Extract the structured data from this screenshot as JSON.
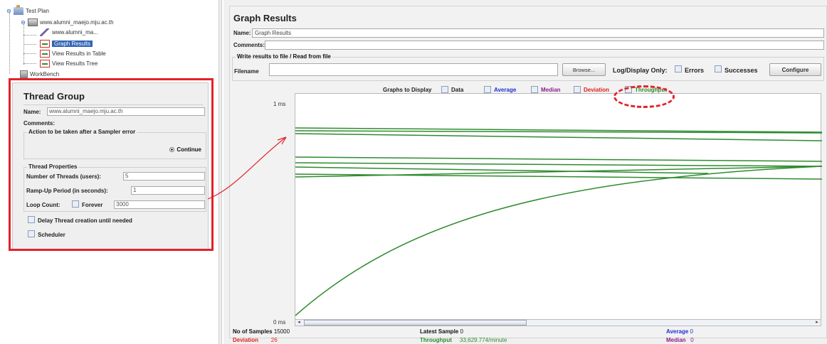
{
  "tree": {
    "test_plan": "Test Plan",
    "thread_group": "www.alumni_maejo.mju.ac.th",
    "sampler": "www.alumni_ma...",
    "graph_results": "Graph Results",
    "view_table": "View Results in Table",
    "view_tree": "View Results Tree",
    "workbench": "WorkBench"
  },
  "thread_group_panel": {
    "title": "Thread Group",
    "name_label": "Name:",
    "name_value": "www.alumni_maejo.mju.ac.th",
    "comments_label": "Comments:",
    "error_group": "Action to be taken after a Sampler error",
    "continue_label": "Continue",
    "properties_group": "Thread Properties",
    "threads_label": "Number of Threads (users):",
    "threads_value": "5",
    "rampup_label": "Ramp-Up Period (in seconds):",
    "rampup_value": "1",
    "loop_label": "Loop Count:",
    "forever_label": "Forever",
    "loop_value": "3000",
    "delay_label": "Delay Thread creation until needed",
    "scheduler_label": "Scheduler"
  },
  "graph_panel": {
    "title": "Graph Results",
    "name_label": "Name:",
    "name_value": "Graph Results",
    "comments_label": "Comments:",
    "file_group": "Write results to file / Read from file",
    "filename_label": "Filename",
    "browse_label": "Browse...",
    "logdisplay_label": "Log/Display Only:",
    "errors_label": "Errors",
    "successes_label": "Successes",
    "configure_label": "Configure",
    "graphs_to_display": "Graphs to Display",
    "legend": {
      "data": "Data",
      "average": "Average",
      "median": "Median",
      "deviation": "Deviation",
      "throughput": "Throughput"
    },
    "y_top": "1 ms",
    "y_bottom": "0 ms"
  },
  "stats": {
    "samples_label": "No of Samples",
    "samples_value": "15000",
    "latest_label": "Latest Sample",
    "latest_value": "0",
    "average_label": "Average",
    "average_value": "0",
    "deviation_label": "Deviation",
    "deviation_value": "26",
    "throughput_label": "Throughput",
    "throughput_value": "33,629.774/minute",
    "median_label": "Median",
    "median_value": "0"
  },
  "colors": {
    "accent_red": "#e1232b",
    "throughput_green": "#2e8b2e",
    "average_blue": "#1f2fd6",
    "median_purple": "#8a1f8a",
    "deviation_red": "#e02020",
    "selection_blue": "#2f63b4"
  }
}
